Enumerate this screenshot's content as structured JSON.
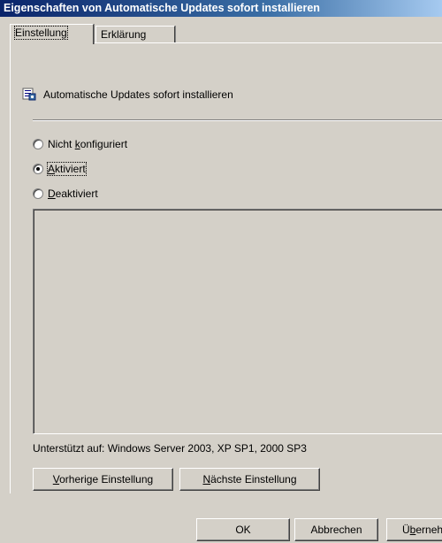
{
  "window": {
    "title": "Eigenschaften von Automatische Updates sofort installieren"
  },
  "tabs": [
    {
      "label": "Einstellung",
      "active": true
    },
    {
      "label": "Erklärung",
      "active": false
    }
  ],
  "policy": {
    "title": "Automatische Updates sofort installieren",
    "icon": "policy-icon"
  },
  "options": {
    "not_configured": {
      "pre": "Nicht ",
      "key": "k",
      "post": "onfiguriert",
      "selected": false
    },
    "enabled": {
      "pre": "",
      "key": "A",
      "post": "ktiviert",
      "selected": true
    },
    "disabled": {
      "pre": "",
      "key": "D",
      "post": "eaktiviert",
      "selected": false
    }
  },
  "supported": "Unterstützt auf:  Windows Server 2003, XP SP1, 2000 SP3",
  "buttons": {
    "previous": {
      "key": "V",
      "rest": "orherige Einstellung"
    },
    "next": {
      "key": "N",
      "rest": "ächste Einstellung"
    },
    "ok": "OK",
    "cancel": "Abbrechen",
    "apply": {
      "pre": "Ü",
      "key": "b",
      "rest": "ernehmen"
    }
  }
}
